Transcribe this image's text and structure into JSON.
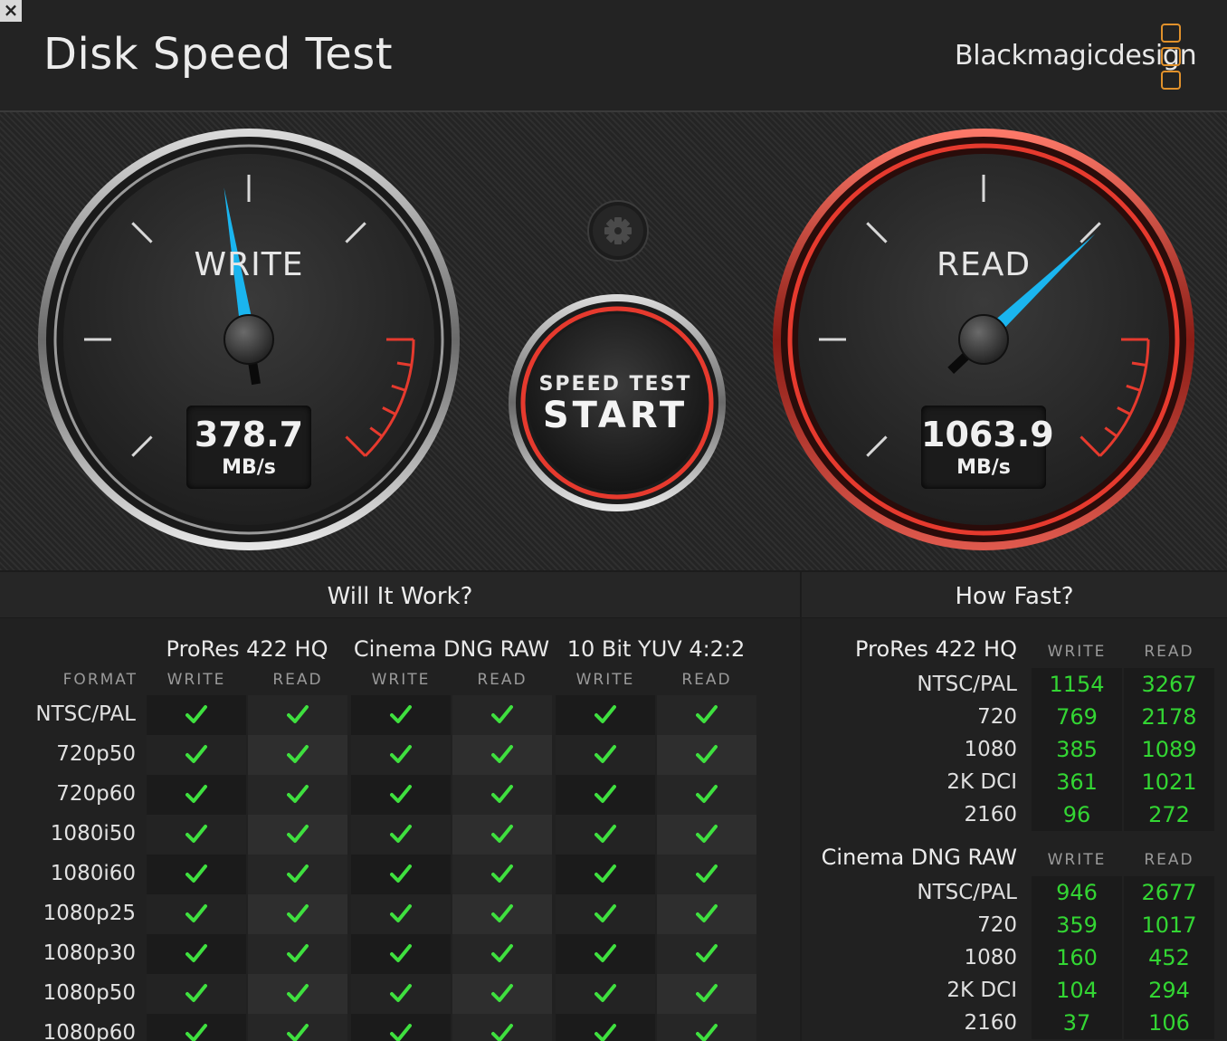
{
  "window": {
    "close_icon": "×"
  },
  "header": {
    "title": "Disk Speed Test",
    "brand": "Blackmagicdesign",
    "logo": "blackmagic-logo-icon"
  },
  "colors": {
    "accent": "#1ab5ef",
    "redline": "#e63a2e",
    "check": "#3fe03f",
    "value_green": "#33d633",
    "logo_orange": "#e1912b"
  },
  "gauges": {
    "write": {
      "label": "WRITE",
      "value": "378.7",
      "unit": "MB/s",
      "needle_value": 378.7
    },
    "read": {
      "label": "READ",
      "value": "1063.9",
      "unit": "MB/s",
      "needle_value": 1063.9
    }
  },
  "start_button": {
    "line1": "SPEED TEST",
    "line2": "START"
  },
  "settings": {
    "icon": "gear-icon"
  },
  "will_it_work": {
    "title": "Will It Work?",
    "format_header": "FORMAT",
    "groups": [
      {
        "name": "ProRes 422 HQ",
        "write": "WRITE",
        "read": "READ"
      },
      {
        "name": "Cinema DNG RAW",
        "write": "WRITE",
        "read": "READ"
      },
      {
        "name": "10 Bit YUV 4:2:2",
        "write": "WRITE",
        "read": "READ"
      }
    ],
    "rows": [
      {
        "format": "NTSC/PAL",
        "checks": [
          true,
          true,
          true,
          true,
          true,
          true
        ]
      },
      {
        "format": "720p50",
        "checks": [
          true,
          true,
          true,
          true,
          true,
          true
        ]
      },
      {
        "format": "720p60",
        "checks": [
          true,
          true,
          true,
          true,
          true,
          true
        ]
      },
      {
        "format": "1080i50",
        "checks": [
          true,
          true,
          true,
          true,
          true,
          true
        ]
      },
      {
        "format": "1080i60",
        "checks": [
          true,
          true,
          true,
          true,
          true,
          true
        ]
      },
      {
        "format": "1080p25",
        "checks": [
          true,
          true,
          true,
          true,
          true,
          true
        ]
      },
      {
        "format": "1080p30",
        "checks": [
          true,
          true,
          true,
          true,
          true,
          true
        ]
      },
      {
        "format": "1080p50",
        "checks": [
          true,
          true,
          true,
          true,
          true,
          true
        ]
      },
      {
        "format": "1080p60",
        "checks": [
          true,
          true,
          true,
          true,
          true,
          true
        ]
      }
    ]
  },
  "how_fast": {
    "title": "How Fast?",
    "sections": [
      {
        "name": "ProRes 422 HQ",
        "write": "WRITE",
        "read": "READ",
        "rows": [
          {
            "label": "NTSC/PAL",
            "write": "1154",
            "read": "3267"
          },
          {
            "label": "720",
            "write": "769",
            "read": "2178"
          },
          {
            "label": "1080",
            "write": "385",
            "read": "1089"
          },
          {
            "label": "2K DCI",
            "write": "361",
            "read": "1021"
          },
          {
            "label": "2160",
            "write": "96",
            "read": "272"
          }
        ]
      },
      {
        "name": "Cinema DNG RAW",
        "write": "WRITE",
        "read": "READ",
        "rows": [
          {
            "label": "NTSC/PAL",
            "write": "946",
            "read": "2677"
          },
          {
            "label": "720",
            "write": "359",
            "read": "1017"
          },
          {
            "label": "1080",
            "write": "160",
            "read": "452"
          },
          {
            "label": "2K DCI",
            "write": "104",
            "read": "294"
          },
          {
            "label": "2160",
            "write": "37",
            "read": "106"
          }
        ]
      }
    ]
  }
}
